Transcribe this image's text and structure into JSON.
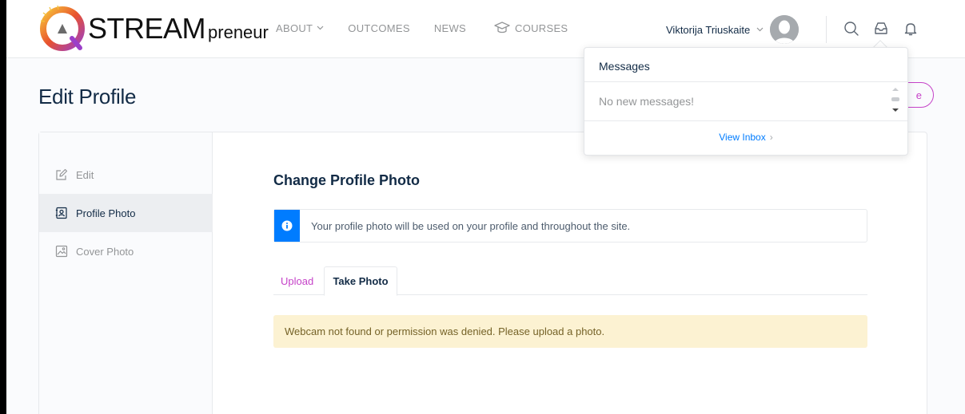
{
  "header": {
    "logo_main": "STREAM",
    "logo_sub": "preneur",
    "nav": [
      {
        "label": "ABOUT"
      },
      {
        "label": "OUTCOMES"
      },
      {
        "label": "NEWS"
      },
      {
        "label": "COURSES"
      }
    ],
    "user_name": "Viktorija Triuskaite"
  },
  "page": {
    "title": "Edit Profile",
    "pill_label": "e"
  },
  "sidebar": {
    "items": [
      {
        "label": "Edit"
      },
      {
        "label": "Profile Photo"
      },
      {
        "label": "Cover Photo"
      }
    ]
  },
  "main": {
    "section_title": "Change Profile Photo",
    "info_text": "Your profile photo will be used on your profile and throughout the site.",
    "tabs": [
      {
        "label": "Upload"
      },
      {
        "label": "Take Photo"
      }
    ],
    "warning": "Webcam not found or permission was denied. Please upload a photo."
  },
  "messages": {
    "title": "Messages",
    "empty_text": "No new messages!",
    "view_inbox": "View Inbox",
    "view_inbox_arrow": "›"
  },
  "colors": {
    "accent": "#c542c8",
    "info": "#007cff",
    "warning_bg": "#fcf2d2",
    "text": "#122b46"
  }
}
